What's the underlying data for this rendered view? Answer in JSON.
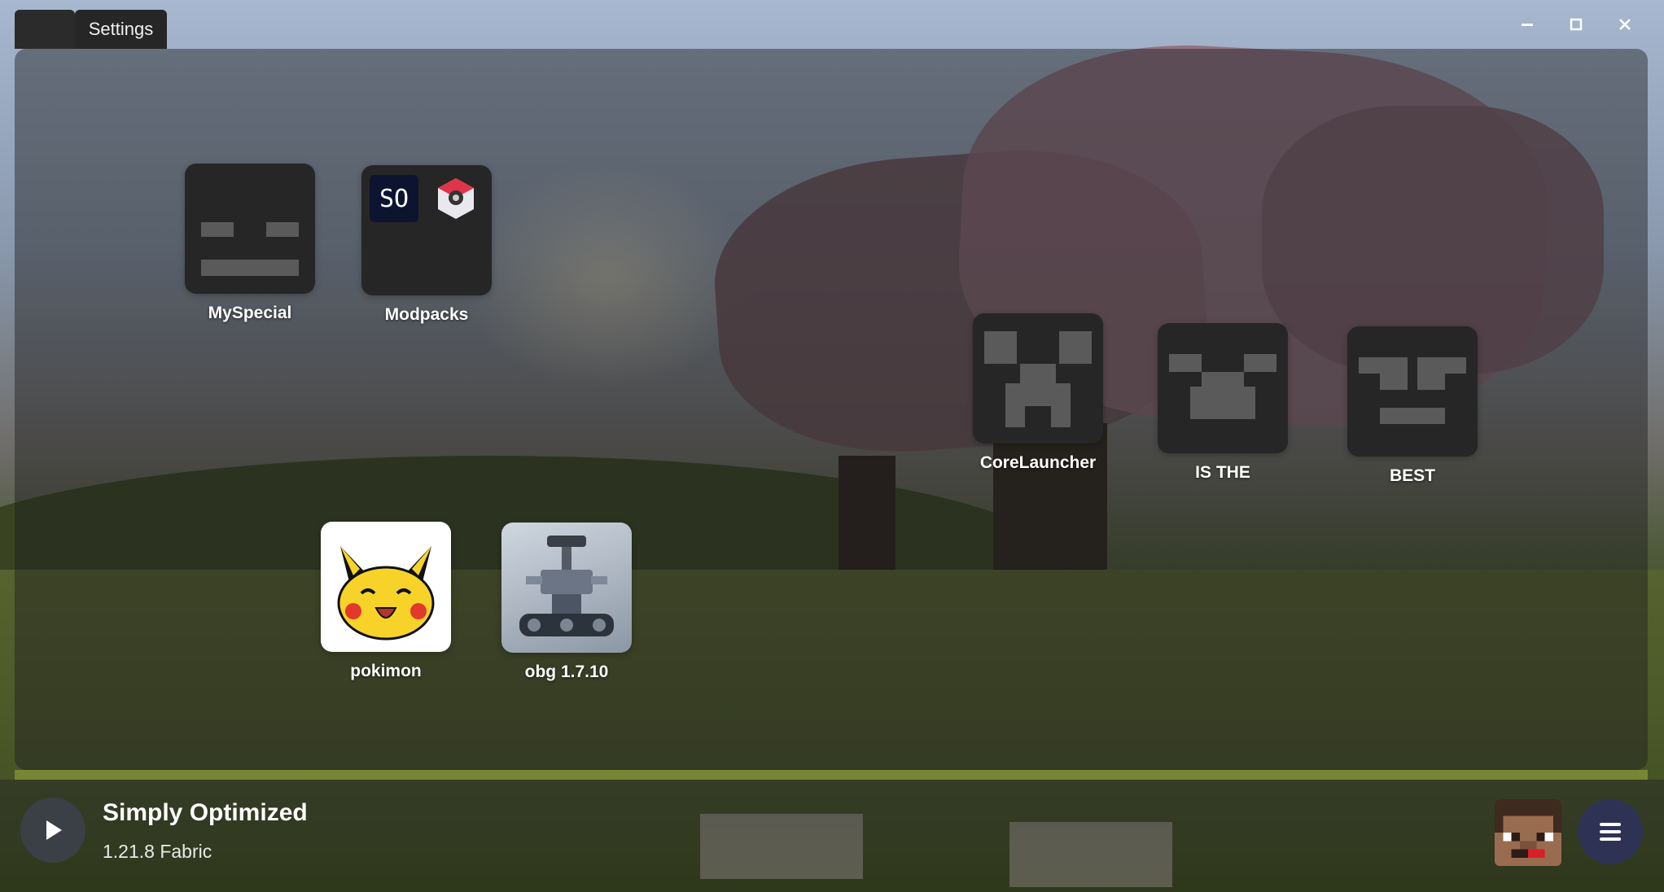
{
  "titlebar": {
    "settings_tab": "Settings",
    "controls": [
      "minimize-icon",
      "maximize-icon",
      "close-icon"
    ]
  },
  "instances": [
    {
      "label": "MySpecial",
      "icon": "blank-face-icon"
    },
    {
      "label": "Modpacks",
      "icon": "folder-icon",
      "badge_text": "SO"
    },
    {
      "label": "CoreLauncher",
      "icon": "creeper-face-icon"
    },
    {
      "label": "IS THE",
      "icon": "smile-face-icon"
    },
    {
      "label": "BEST",
      "icon": "grin-face-icon"
    },
    {
      "label": "pokimon",
      "icon": "pikachu-icon"
    },
    {
      "label": "obg 1.7.10",
      "icon": "robot-image-icon"
    }
  ],
  "now_playing": {
    "title": "Simply Optimized",
    "subtitle": "1.21.8 Fabric"
  },
  "colors": {
    "tile_bg": "#262626",
    "face_block": "#5a5a5a",
    "menu_button": "#2e3356",
    "play_button": "#3b4047"
  }
}
